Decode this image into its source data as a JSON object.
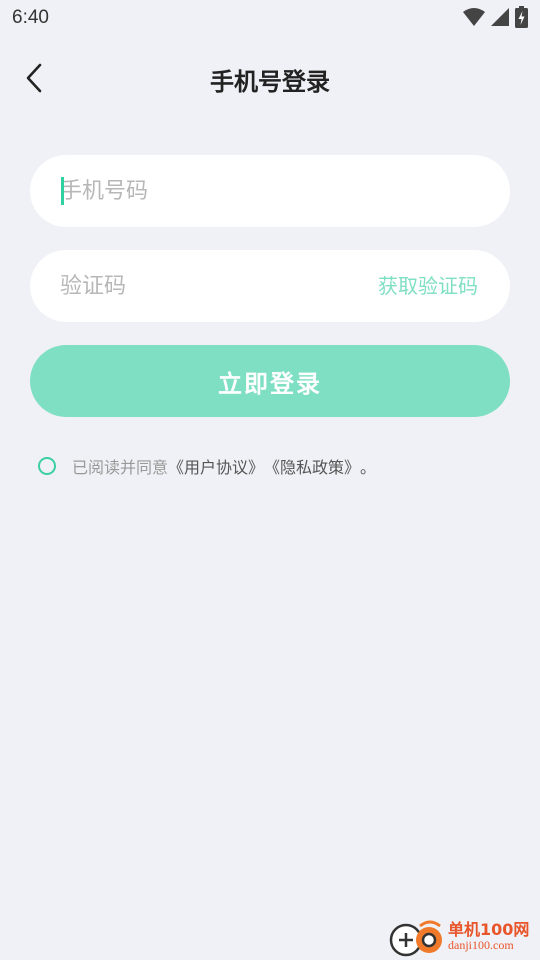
{
  "status_bar": {
    "time": "6:40",
    "icons": [
      "wifi-icon",
      "cellular-signal-icon",
      "battery-charging-icon"
    ]
  },
  "header": {
    "back_icon": "chevron-left-icon",
    "title": "手机号登录"
  },
  "phone_field": {
    "placeholder": "手机号码",
    "value": ""
  },
  "code_field": {
    "placeholder": "验证码",
    "value": "",
    "get_code_label": "获取验证码"
  },
  "login_button": {
    "label": "立即登录"
  },
  "agreement": {
    "checked": false,
    "prefix": "已阅读并同意",
    "user_agreement": "《用户协议》",
    "privacy_policy": "《隐私政策》",
    "suffix": "。"
  },
  "watermark": {
    "name": "单机100网",
    "url": "danji100.com"
  },
  "colors": {
    "background": "#f0f1f6",
    "accent": "#3ccfa3",
    "button_disabled": "#7fdfc3",
    "watermark": "#e8552a"
  }
}
